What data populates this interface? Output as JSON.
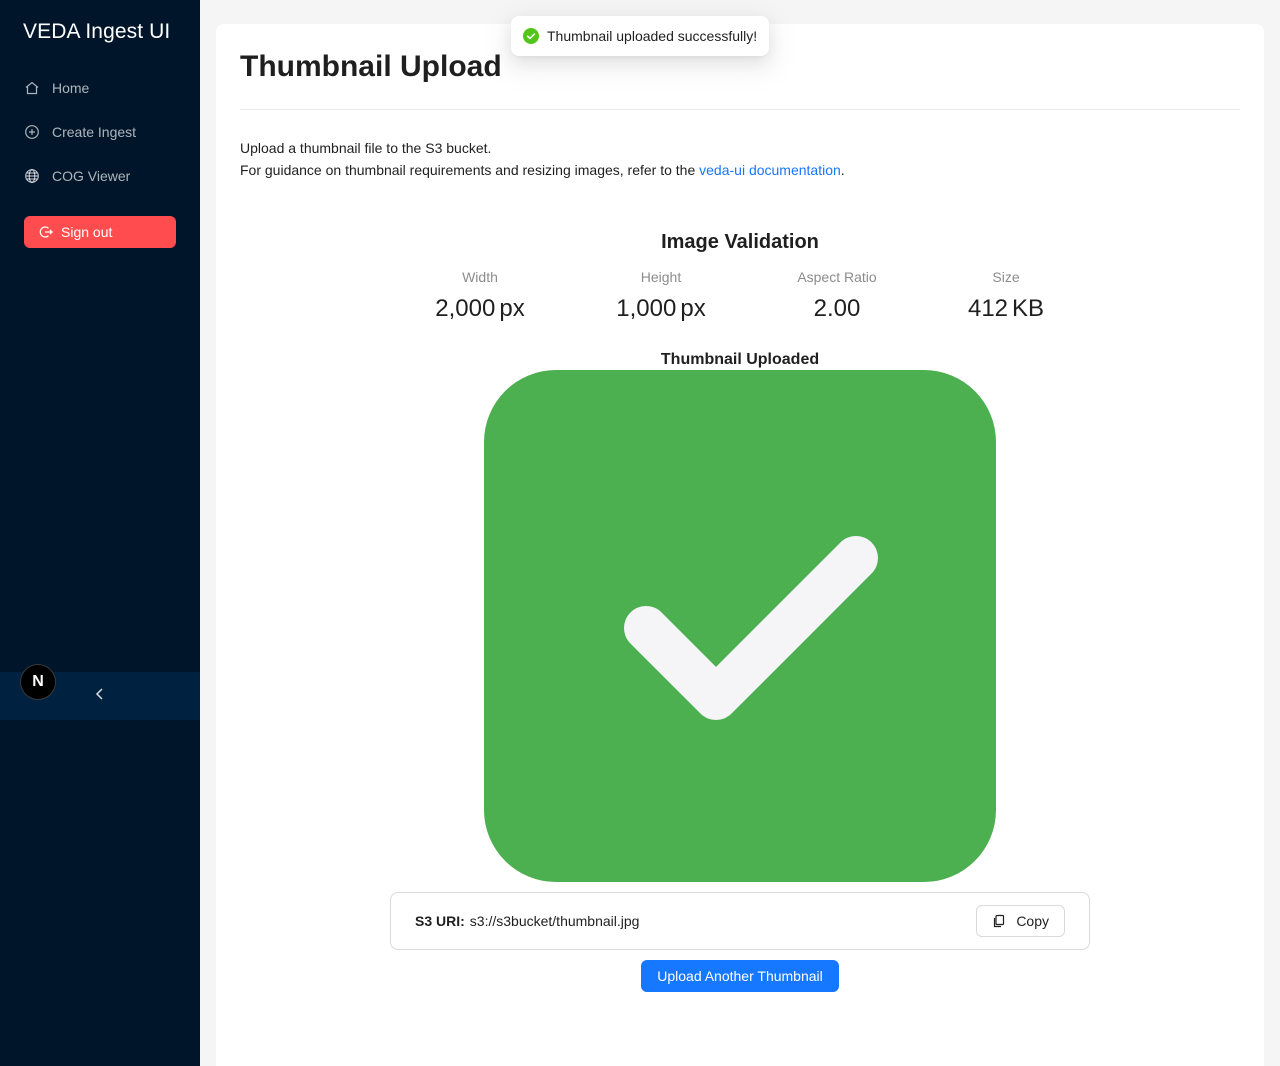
{
  "sidebar": {
    "app_title": "VEDA Ingest UI",
    "items": [
      {
        "label": "Home",
        "icon": "home-icon"
      },
      {
        "label": "Create Ingest",
        "icon": "plus-circle-icon"
      },
      {
        "label": "COG Viewer",
        "icon": "globe-icon"
      }
    ],
    "sign_out_label": "Sign out",
    "badge_letter": "N",
    "colors": {
      "background": "#001529",
      "sign_out": "#ff4d4f"
    }
  },
  "toast": {
    "message": "Thumbnail uploaded successfully!",
    "icon": "check-circle-icon"
  },
  "main": {
    "title": "Thumbnail Upload",
    "desc_line1": "Upload a thumbnail file to the S3 bucket.",
    "desc_line2_prefix": "For guidance on thumbnail requirements and resizing images, refer to the ",
    "desc_link": "veda-ui documentation",
    "desc_line2_suffix": ".",
    "validation_title": "Image Validation",
    "stats": [
      {
        "label": "Width",
        "value": "2,000",
        "unit": "px"
      },
      {
        "label": "Height",
        "value": "1,000",
        "unit": "px"
      },
      {
        "label": "Aspect Ratio",
        "value": "2.00",
        "unit": ""
      },
      {
        "label": "Size",
        "value": "412",
        "unit": "KB"
      }
    ],
    "thumbnail_label": "Thumbnail Uploaded",
    "s3_uri_label": "S3 URI:",
    "s3_uri_value": "s3://s3bucket/thumbnail.jpg",
    "copy_label": "Copy",
    "upload_another_label": "Upload Another Thumbnail",
    "colors": {
      "primary": "#1677ff",
      "success": "#4caf50",
      "link": "#1677ff"
    }
  }
}
